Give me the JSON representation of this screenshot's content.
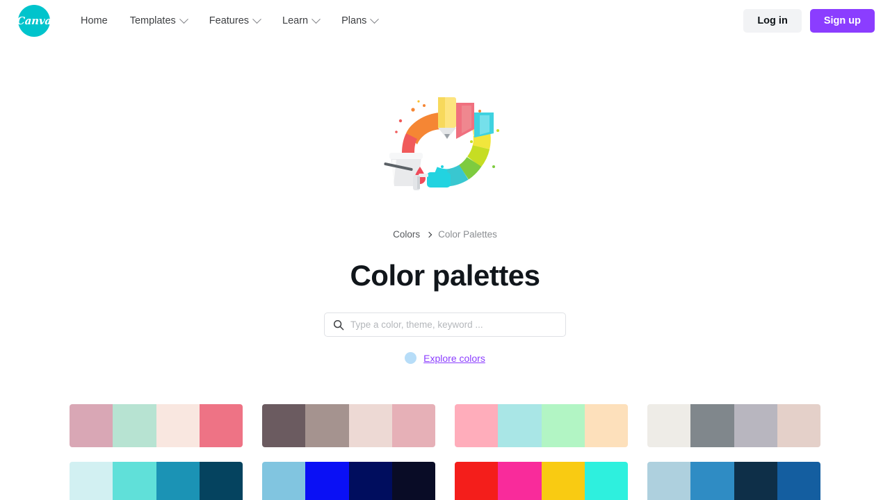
{
  "header": {
    "logo_name": "Canva",
    "nav": [
      {
        "label": "Home",
        "has_menu": false
      },
      {
        "label": "Templates",
        "has_menu": true
      },
      {
        "label": "Features",
        "has_menu": true
      },
      {
        "label": "Learn",
        "has_menu": true
      },
      {
        "label": "Plans",
        "has_menu": true
      }
    ],
    "login_label": "Log in",
    "signup_label": "Sign up",
    "signup_color": "#8b3dff",
    "logo_color": "#00c4cc"
  },
  "hero": {
    "breadcrumb": {
      "parent": "Colors",
      "current": "Color Palettes"
    },
    "title": "Color palettes",
    "search": {
      "placeholder": "Type a color, theme, keyword ...",
      "value": "",
      "icon": "search-icon"
    },
    "explore": {
      "label": "Explore colors",
      "dot_color": "#b7ddf8",
      "link_color": "#8b3dff"
    }
  },
  "palettes": [
    {
      "name": "palette-1",
      "colors": [
        "#d9a7b5",
        "#b7e3d2",
        "#f9e7e0",
        "#ee7385"
      ]
    },
    {
      "name": "palette-2",
      "colors": [
        "#6b5b60",
        "#a5938f",
        "#edd9d4",
        "#e6b0b7"
      ]
    },
    {
      "name": "palette-3",
      "colors": [
        "#ffadbb",
        "#a9e6e6",
        "#b2f5c4",
        "#fde0bb"
      ]
    },
    {
      "name": "palette-4",
      "colors": [
        "#eeece7",
        "#80878c",
        "#b8b6bf",
        "#e4d0c9"
      ]
    },
    {
      "name": "palette-5",
      "colors": [
        "#d2f0f2",
        "#60e0d9",
        "#1b93b5",
        "#05435f"
      ]
    },
    {
      "name": "palette-6",
      "colors": [
        "#81c5e0",
        "#0a10f5",
        "#000d5e",
        "#090c26"
      ]
    },
    {
      "name": "palette-7",
      "colors": [
        "#f41e1b",
        "#f92b9b",
        "#f9cb12",
        "#2ef0de"
      ]
    },
    {
      "name": "palette-8",
      "colors": [
        "#aed0de",
        "#2f8cc4",
        "#0e2f48",
        "#145ea0"
      ]
    }
  ]
}
